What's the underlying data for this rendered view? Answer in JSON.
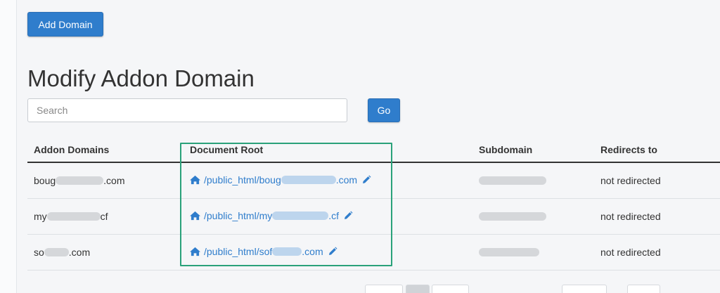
{
  "toolbar": {
    "add_domain_label": "Add Domain"
  },
  "page": {
    "title": "Modify Addon Domain"
  },
  "search": {
    "placeholder": "Search",
    "go_label": "Go"
  },
  "table": {
    "headers": {
      "addon_domains": "Addon Domains",
      "document_root": "Document Root",
      "subdomain": "Subdomain",
      "redirects_to": "Redirects to"
    },
    "rows": [
      {
        "domain_prefix": "boug",
        "domain_suffix": ".com",
        "root_prefix": "/public_html/boug",
        "root_suffix": ".com",
        "redirects": "not redirected"
      },
      {
        "domain_prefix": "my",
        "domain_suffix": "cf",
        "root_prefix": "/public_html/my",
        "root_suffix": ".cf",
        "redirects": "not redirected"
      },
      {
        "domain_prefix": "so",
        "domain_suffix": ".com",
        "root_prefix": "/public_html/sof",
        "root_suffix": ".com",
        "redirects": "not redirected"
      }
    ]
  },
  "colors": {
    "primary_button": "#2f7dcc",
    "link": "#2f7dcc",
    "highlight_box": "#2aa27a",
    "text": "#333333"
  },
  "icons": {
    "document_root": "home-icon",
    "edit": "pencil-icon"
  }
}
